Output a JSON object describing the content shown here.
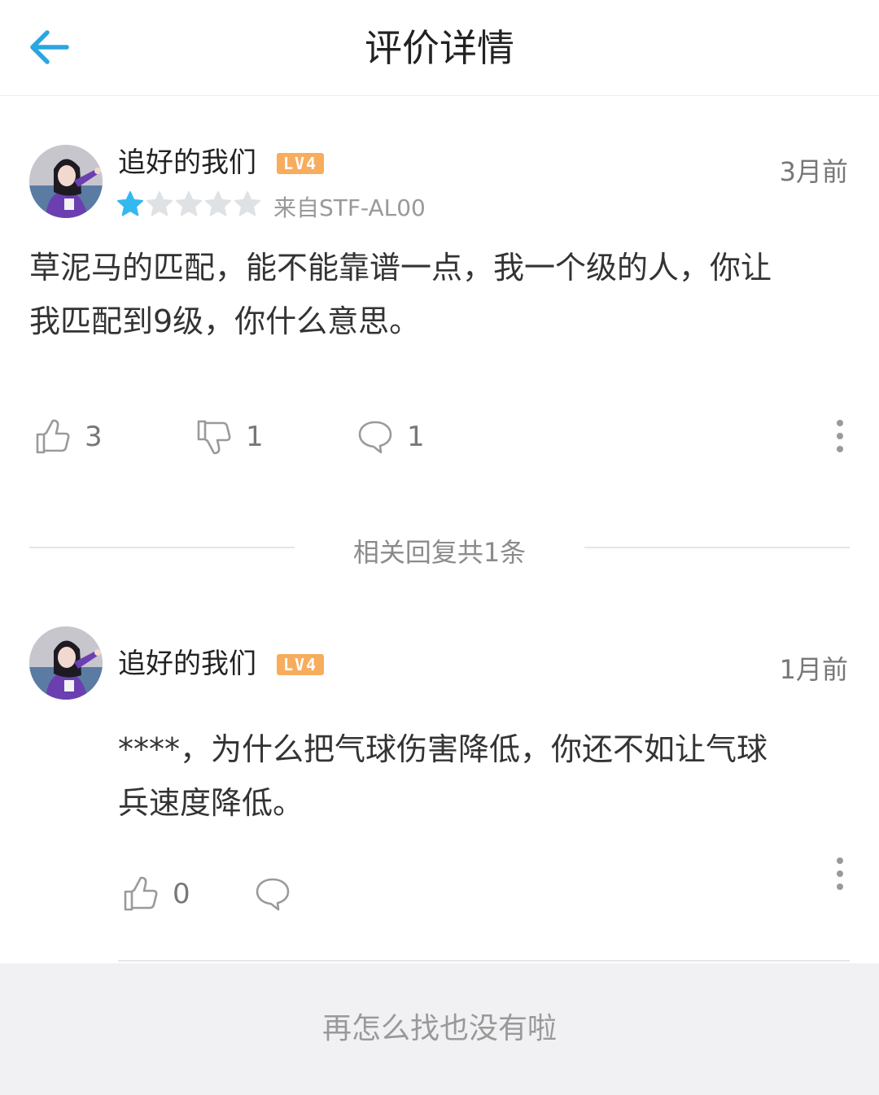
{
  "header": {
    "title": "评价详情"
  },
  "review": {
    "username": "追好的我们",
    "level": "LV4",
    "time": "3月前",
    "rating": 1,
    "rating_max": 5,
    "device": "来自STF-AL00",
    "text_line1": "草泥马的匹配，能不能靠谱一点，我一个级的人，你让",
    "text_line2": "我匹配到9级，你什么意思。",
    "likes": "3",
    "dislikes": "1",
    "comments": "1"
  },
  "replies_section": {
    "label": "相关回复共1条"
  },
  "reply": {
    "username": "追好的我们",
    "level": "LV4",
    "time": "1月前",
    "text_line1": "****，为什么把气球伤害降低，你还不如让气球",
    "text_line2": "兵速度降低。",
    "likes": "0"
  },
  "footer": {
    "text": "再怎么找也没有啦"
  },
  "colors": {
    "accent": "#2aa6e0",
    "star_filled": "#35b8f0",
    "star_empty": "#dfe2e5",
    "badge": "#f7ad5d",
    "footer_bg": "#f1f1f3"
  },
  "icons": {
    "back": "arrow-left-icon",
    "like": "thumbs-up-icon",
    "dislike": "thumbs-down-icon",
    "comment": "speech-bubble-icon",
    "more": "more-vertical-icon"
  }
}
